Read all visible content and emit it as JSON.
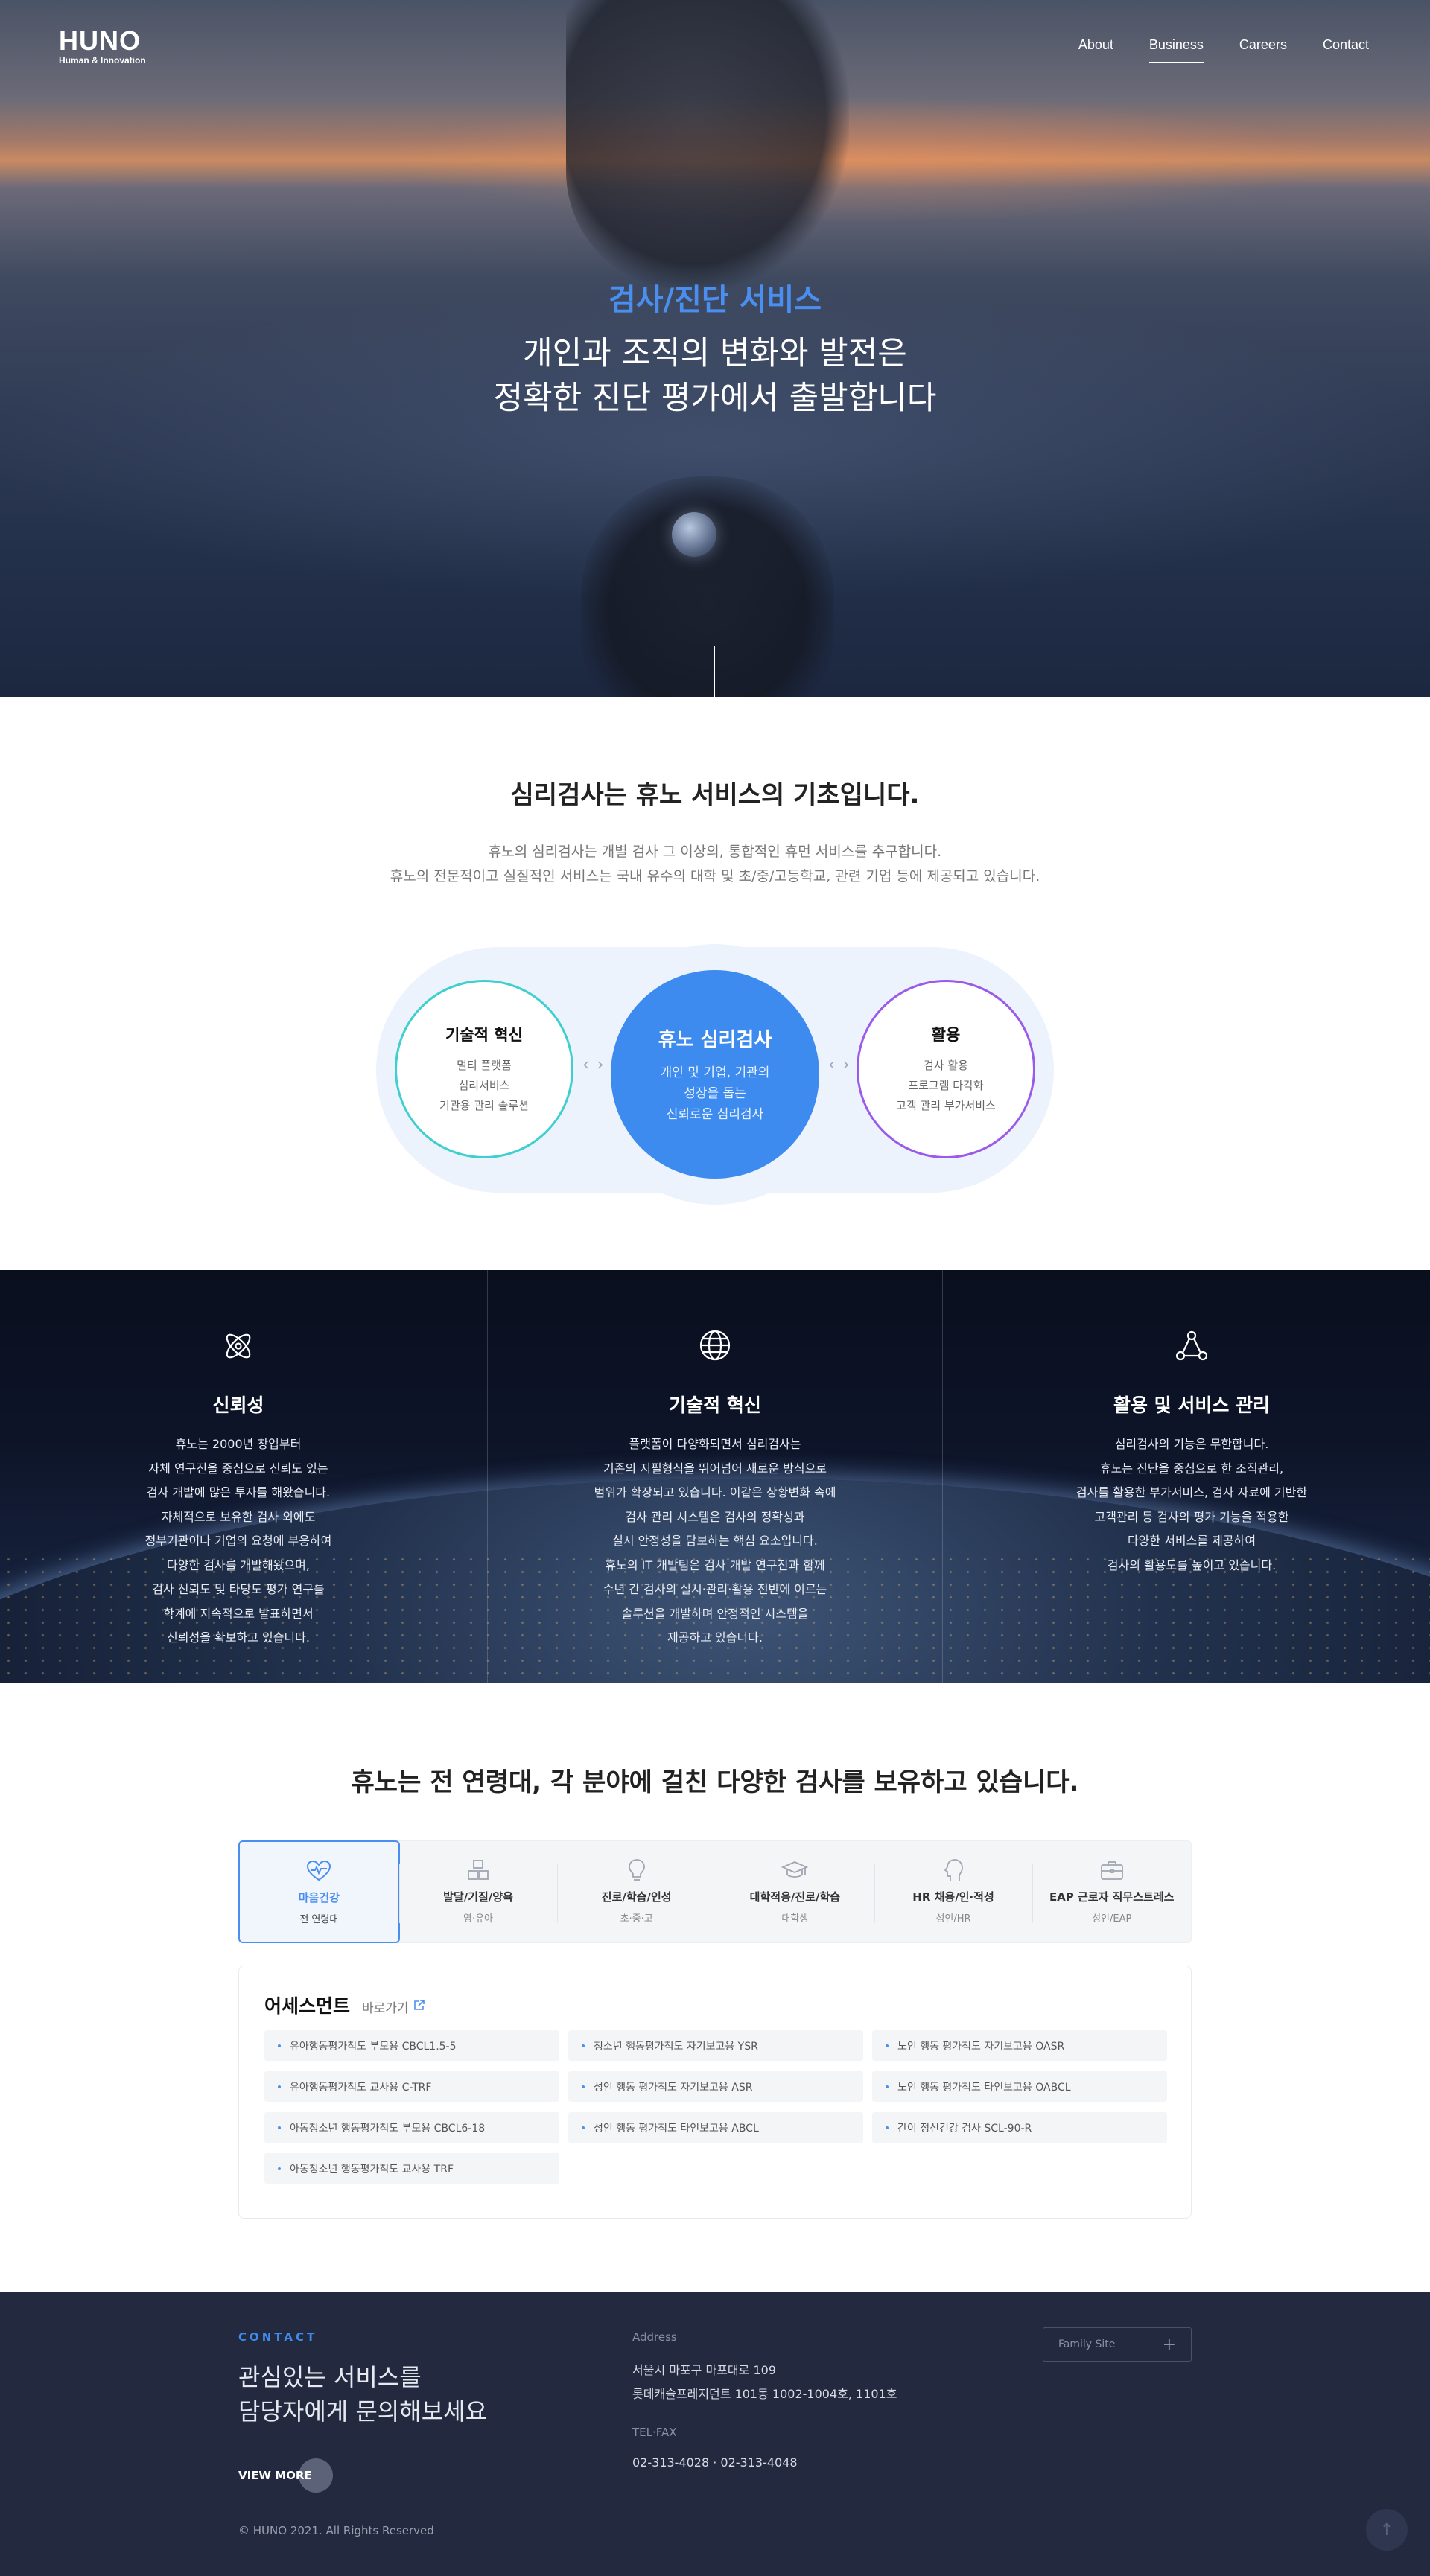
{
  "header": {
    "logo_main": "HUNO",
    "logo_sub": "Human & Innovation",
    "nav": [
      "About",
      "Business",
      "Careers",
      "Contact"
    ],
    "active_nav": "Business"
  },
  "hero": {
    "title": "검사/진단 서비스",
    "line1": "개인과 조직의 변화와 발전은",
    "line2": "정확한 진단 평가에서 출발합니다"
  },
  "intro": {
    "title_bold": "심리검사",
    "title_rest": "는 휴노 서비스의 기초입니다.",
    "desc1": "휴노의 심리검사는 개별 검사 그 이상의, 통합적인 휴먼 서비스를 추구합니다.",
    "desc2": "휴노의 전문적이고 실질적인 서비스는 국내 유수의 대학 및 초/중/고등학교, 관련 기업 등에 제공되고 있습니다."
  },
  "circles": {
    "left": {
      "title": "기술적 혁신",
      "lines": [
        "멀티 플랫폼",
        "심리서비스",
        "기관용 관리 솔루션"
      ]
    },
    "middle": {
      "title": "휴노 심리검사",
      "lines": [
        "개인 및 기업, 기관의",
        "성장을 돕는",
        "신뢰로운 심리검사"
      ]
    },
    "right": {
      "title": "활용",
      "lines": [
        "검사 활용",
        "프로그램 다각화",
        "고객 관리 부가서비스"
      ]
    },
    "arrow": "‹ ›",
    "colors": {
      "left": "#3fcfcf",
      "middle": "#3d8bef",
      "right": "#9b5bea"
    }
  },
  "features": [
    {
      "icon": "atom-icon",
      "title": "신뢰성",
      "lines": [
        "휴노는 2000년 창업부터",
        "자체 연구진을 중심으로 신뢰도 있는",
        "검사 개발에 많은 투자를 해왔습니다.",
        "자체적으로 보유한 검사 외에도",
        "정부기관이나 기업의 요청에 부응하여",
        "다양한 검사를 개발해왔으며,",
        "검사 신뢰도 및 타당도 평가 연구를",
        "학계에 지속적으로 발표하면서",
        "신뢰성을 확보하고 있습니다."
      ]
    },
    {
      "icon": "globe-icon",
      "title": "기술적 혁신",
      "lines": [
        "플랫폼이 다양화되면서 심리검사는",
        "기존의 지필형식을 뛰어넘어 새로운 방식으로",
        "범위가 확장되고 있습니다. 이같은 상황변화 속에",
        "검사 관리 시스템은 검사의 정확성과",
        "실시 안정성을 담보하는 핵심 요소입니다.",
        "휴노의 IT 개발팀은 검사 개발 연구진과 함께",
        "수년 간 검사의 실시·관리·활용 전반에 이르는",
        "솔루션을 개발하며 안정적인 시스템을",
        "제공하고 있습니다."
      ]
    },
    {
      "icon": "network-icon",
      "title": "활용 및 서비스 관리",
      "lines": [
        "심리검사의 기능은 무한합니다.",
        "휴노는 진단을 중심으로 한 조직관리,",
        "검사를 활용한 부가서비스, 검사 자료에 기반한",
        "고객관리 등 검사의 평가 기능을 적용한",
        "다양한 서비스를 제공하여",
        "검사의 활용도를 높이고 있습니다."
      ]
    }
  ],
  "tests": {
    "title_pre": "휴노는 ",
    "title_bold": "전 연령대, 각 분야에 걸친 다양한 검사",
    "title_post": "를 보유하고 있습니다.",
    "tabs": [
      {
        "icon": "heartbeat-icon",
        "label": "마음건강",
        "sub": "전 연령대"
      },
      {
        "icon": "blocks-icon",
        "label": "발달/기질/양육",
        "sub": "영·유아"
      },
      {
        "icon": "lightbulb-icon",
        "label": "진로/학습/인성",
        "sub": "초·중·고"
      },
      {
        "icon": "graduation-cap-icon",
        "label": "대학적응/진로/학습",
        "sub": "대학생"
      },
      {
        "icon": "head-icon",
        "label": "HR 채용/인·적성",
        "sub": "성인/HR"
      },
      {
        "icon": "briefcase-icon",
        "label": "EAP 근로자 직무스트레스",
        "sub": "성인/EAP"
      }
    ],
    "accent": "#4a8ff0"
  },
  "assessment": {
    "title": "어세스먼트",
    "link": "바로가기",
    "items": [
      "유아행동평가척도 부모용 CBCL1.5-5",
      "청소년 행동평가척도 자기보고용 YSR",
      "노인 행동 평가척도 자기보고용 OASR",
      "유아행동평가척도 교사용 C-TRF",
      "성인 행동 평가척도 자기보고용 ASR",
      "노인 행동 평가척도 타인보고용 OABCL",
      "아동청소년 행동평가척도 부모용 CBCL6-18",
      "성인 행동 평가척도 타인보고용 ABCL",
      "간이 정신건강 검사 SCL-90-R",
      "아동청소년 행동평가척도 교사용 TRF"
    ]
  },
  "footer": {
    "contact_label": "CONTACT",
    "head1": "관심있는 서비스를",
    "head2": "담당자에게 문의해보세요",
    "view_more": "VIEW MORE",
    "address_label": "Address",
    "address1": "서울시 마포구 마포대로 109",
    "address2": "롯데캐슬프레지던트 101동 1002-1004호, 1101호",
    "tel_label": "TEL·FAX",
    "tel": "02-313-4028 · 02-313-4048",
    "family_site": "Family Site",
    "copyright": "© HUNO 2021. All Rights Reserved"
  }
}
